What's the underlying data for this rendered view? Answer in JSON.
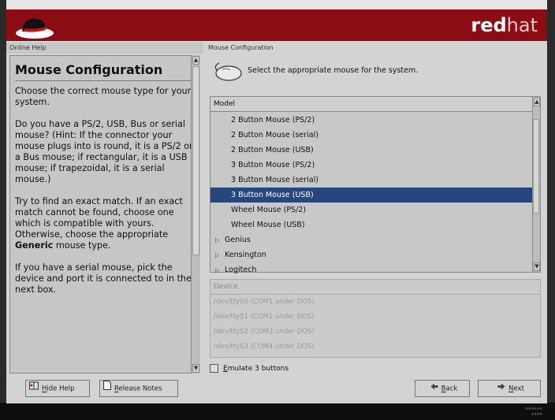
{
  "branding": {
    "brand_bold": "red",
    "brand_light": "hat"
  },
  "help": {
    "header": "Online Help",
    "title": "Mouse Configuration",
    "p1": "Choose the correct mouse type for your system.",
    "p2": "Do you have a PS/2, USB, Bus or serial mouse? (Hint: If the connector your mouse plugs into is round, it is a PS/2 or a Bus mouse; if rectangular, it is a USB mouse; if trapezoidal, it is a serial mouse.)",
    "p3_pre": "Try to find an exact match. If an exact match cannot be found, choose one which is compatible with yours. Otherwise, choose the appropriate ",
    "p3_bold": "Generic",
    "p3_post": " mouse type.",
    "p4": "If you have a serial mouse, pick the device and port it is connected to in the next box."
  },
  "main": {
    "header": "Mouse Configuration",
    "intro": "Select the appropriate mouse for the system.",
    "model_column": "Model",
    "models": [
      {
        "label": "2 Button Mouse (PS/2)",
        "kind": "item",
        "selected": false
      },
      {
        "label": "2 Button Mouse (serial)",
        "kind": "item",
        "selected": false
      },
      {
        "label": "2 Button Mouse (USB)",
        "kind": "item",
        "selected": false
      },
      {
        "label": "3 Button Mouse (PS/2)",
        "kind": "item",
        "selected": false
      },
      {
        "label": "3 Button Mouse (serial)",
        "kind": "item",
        "selected": false
      },
      {
        "label": "3 Button Mouse (USB)",
        "kind": "item",
        "selected": true
      },
      {
        "label": "Wheel Mouse (PS/2)",
        "kind": "item",
        "selected": false
      },
      {
        "label": "Wheel Mouse (USB)",
        "kind": "item",
        "selected": false
      },
      {
        "label": "Genius",
        "kind": "group",
        "selected": false
      },
      {
        "label": "Kensington",
        "kind": "group",
        "selected": false
      },
      {
        "label": "Logitech",
        "kind": "group",
        "selected": false
      }
    ],
    "device_column": "Device",
    "devices": [
      "/dev/ttyS0 (COM1 under DOS)",
      "/dev/ttyS1 (COM2 under DOS)",
      "/dev/ttyS2 (COM3 under DOS)",
      "/dev/ttyS3 (COM4 under DOS)"
    ],
    "emulate_label_u": "E",
    "emulate_label_rest": "mulate 3 buttons",
    "emulate_checked": false
  },
  "buttons": {
    "hide_help_u": "H",
    "hide_help_rest": "ide Help",
    "release_notes_u": "R",
    "release_notes_rest": "elease Notes",
    "back_u": "B",
    "back_rest": "ack",
    "next_u": "N",
    "next_rest": "ext"
  },
  "colors": {
    "banner": "#8c0c13",
    "selection": "#27467e"
  }
}
